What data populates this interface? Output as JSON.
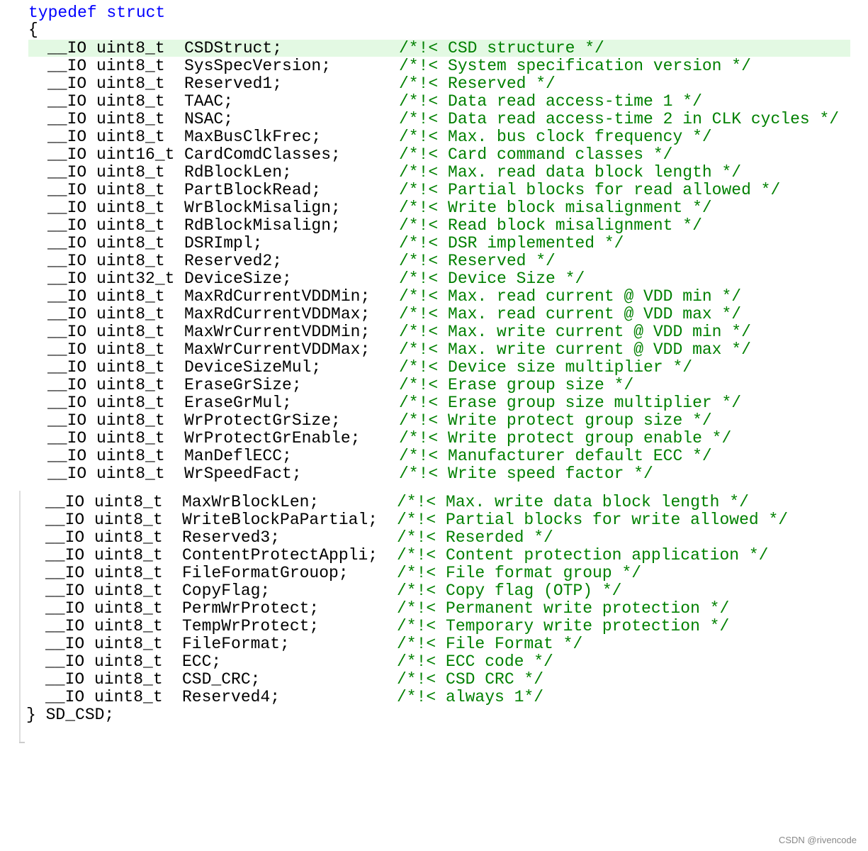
{
  "header": {
    "line": "typedef struct"
  },
  "open_brace": "{",
  "members_block1": [
    {
      "type": "__IO uint8_t",
      "name": "CSDStruct;",
      "comment": "/*!< CSD structure */"
    },
    {
      "type": "__IO uint8_t",
      "name": "SysSpecVersion;",
      "comment": "/*!< System specification version */"
    },
    {
      "type": "__IO uint8_t",
      "name": "Reserved1;",
      "comment": "/*!< Reserved */"
    },
    {
      "type": "__IO uint8_t",
      "name": "TAAC;",
      "comment": "/*!< Data read access-time 1 */"
    },
    {
      "type": "__IO uint8_t",
      "name": "NSAC;",
      "comment": "/*!< Data read access-time 2 in CLK cycles */"
    },
    {
      "type": "__IO uint8_t",
      "name": "MaxBusClkFrec;",
      "comment": "/*!< Max. bus clock frequency */"
    },
    {
      "type": "__IO uint16_t",
      "name": "CardComdClasses;",
      "comment": "/*!< Card command classes */"
    },
    {
      "type": "__IO uint8_t",
      "name": "RdBlockLen;",
      "comment": "/*!< Max. read data block length */"
    },
    {
      "type": "__IO uint8_t",
      "name": "PartBlockRead;",
      "comment": "/*!< Partial blocks for read allowed */"
    },
    {
      "type": "__IO uint8_t",
      "name": "WrBlockMisalign;",
      "comment": "/*!< Write block misalignment */"
    },
    {
      "type": "__IO uint8_t",
      "name": "RdBlockMisalign;",
      "comment": "/*!< Read block misalignment */"
    },
    {
      "type": "__IO uint8_t",
      "name": "DSRImpl;",
      "comment": "/*!< DSR implemented */"
    },
    {
      "type": "__IO uint8_t",
      "name": "Reserved2;",
      "comment": "/*!< Reserved */"
    },
    {
      "type": "__IO uint32_t",
      "name": "DeviceSize;",
      "comment": "/*!< Device Size */"
    },
    {
      "type": "__IO uint8_t",
      "name": "MaxRdCurrentVDDMin;",
      "comment": "/*!< Max. read current @ VDD min */"
    },
    {
      "type": "__IO uint8_t",
      "name": "MaxRdCurrentVDDMax;",
      "comment": "/*!< Max. read current @ VDD max */"
    },
    {
      "type": "__IO uint8_t",
      "name": "MaxWrCurrentVDDMin;",
      "comment": "/*!< Max. write current @ VDD min */"
    },
    {
      "type": "__IO uint8_t",
      "name": "MaxWrCurrentVDDMax;",
      "comment": "/*!< Max. write current @ VDD max */"
    },
    {
      "type": "__IO uint8_t",
      "name": "DeviceSizeMul;",
      "comment": "/*!< Device size multiplier */"
    },
    {
      "type": "__IO uint8_t",
      "name": "EraseGrSize;",
      "comment": "/*!< Erase group size */"
    },
    {
      "type": "__IO uint8_t",
      "name": "EraseGrMul;",
      "comment": "/*!< Erase group size multiplier */"
    },
    {
      "type": "__IO uint8_t",
      "name": "WrProtectGrSize;",
      "comment": "/*!< Write protect group size */"
    },
    {
      "type": "__IO uint8_t",
      "name": "WrProtectGrEnable;",
      "comment": "/*!< Write protect group enable */"
    },
    {
      "type": "__IO uint8_t",
      "name": "ManDeflECC;",
      "comment": "/*!< Manufacturer default ECC */"
    },
    {
      "type": "__IO uint8_t",
      "name": "WrSpeedFact;",
      "comment": "/*!< Write speed factor */"
    }
  ],
  "members_block2": [
    {
      "type": "__IO uint8_t",
      "name": "MaxWrBlockLen;",
      "comment": "/*!< Max. write data block length */"
    },
    {
      "type": "__IO uint8_t",
      "name": "WriteBlockPaPartial;",
      "comment": "/*!< Partial blocks for write allowed */"
    },
    {
      "type": "__IO uint8_t",
      "name": "Reserved3;",
      "comment": "/*!< Reserded */"
    },
    {
      "type": "__IO uint8_t",
      "name": "ContentProtectAppli;",
      "comment": "/*!< Content protection application */"
    },
    {
      "type": "__IO uint8_t",
      "name": "FileFormatGrouop;",
      "comment": "/*!< File format group */"
    },
    {
      "type": "__IO uint8_t",
      "name": "CopyFlag;",
      "comment": "/*!< Copy flag (OTP) */"
    },
    {
      "type": "__IO uint8_t",
      "name": "PermWrProtect;",
      "comment": "/*!< Permanent write protection */"
    },
    {
      "type": "__IO uint8_t",
      "name": "TempWrProtect;",
      "comment": "/*!< Temporary write protection */"
    },
    {
      "type": "__IO uint8_t",
      "name": "FileFormat;",
      "comment": "/*!< File Format */"
    },
    {
      "type": "__IO uint8_t",
      "name": "ECC;",
      "comment": "/*!< ECC code */"
    },
    {
      "type": "__IO uint8_t",
      "name": "CSD_CRC;",
      "comment": "/*!< CSD CRC */"
    },
    {
      "type": "__IO uint8_t",
      "name": "Reserved4;",
      "comment": "/*!< always 1*/"
    }
  ],
  "close_line": "} SD_CSD;",
  "footer": "CSDN @rivencode",
  "colors": {
    "keyword": "#0000ff",
    "comment": "#008000",
    "highlight": "#e3f9e3"
  }
}
